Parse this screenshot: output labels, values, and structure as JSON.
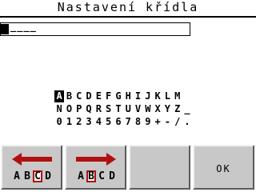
{
  "screen": {
    "title": "Nastavení křídla"
  },
  "input": {
    "placeholder_underscores": "____"
  },
  "keyboard": {
    "rows": [
      [
        "A",
        "B",
        "C",
        "D",
        "E",
        "F",
        "G",
        "H",
        "I",
        "J",
        "K",
        "L",
        "M"
      ],
      [
        "N",
        "O",
        "P",
        "Q",
        "R",
        "S",
        "T",
        "U",
        "V",
        "W",
        "X",
        "Y",
        "Z",
        "_"
      ],
      [
        "0",
        "1",
        "2",
        "3",
        "4",
        "5",
        "6",
        "7",
        "8",
        "9",
        "+",
        "-",
        "/",
        "."
      ]
    ],
    "selected": "A"
  },
  "softkeys": {
    "left": {
      "letters": [
        "A",
        "B",
        "C",
        "D"
      ],
      "highlight": "C"
    },
    "right": {
      "letters": [
        "A",
        "B",
        "C",
        "D"
      ],
      "highlight": "B"
    },
    "empty": "",
    "ok_label": "OK"
  },
  "colors": {
    "arrow": "#b01010",
    "button_face": "#c8c8c8"
  }
}
